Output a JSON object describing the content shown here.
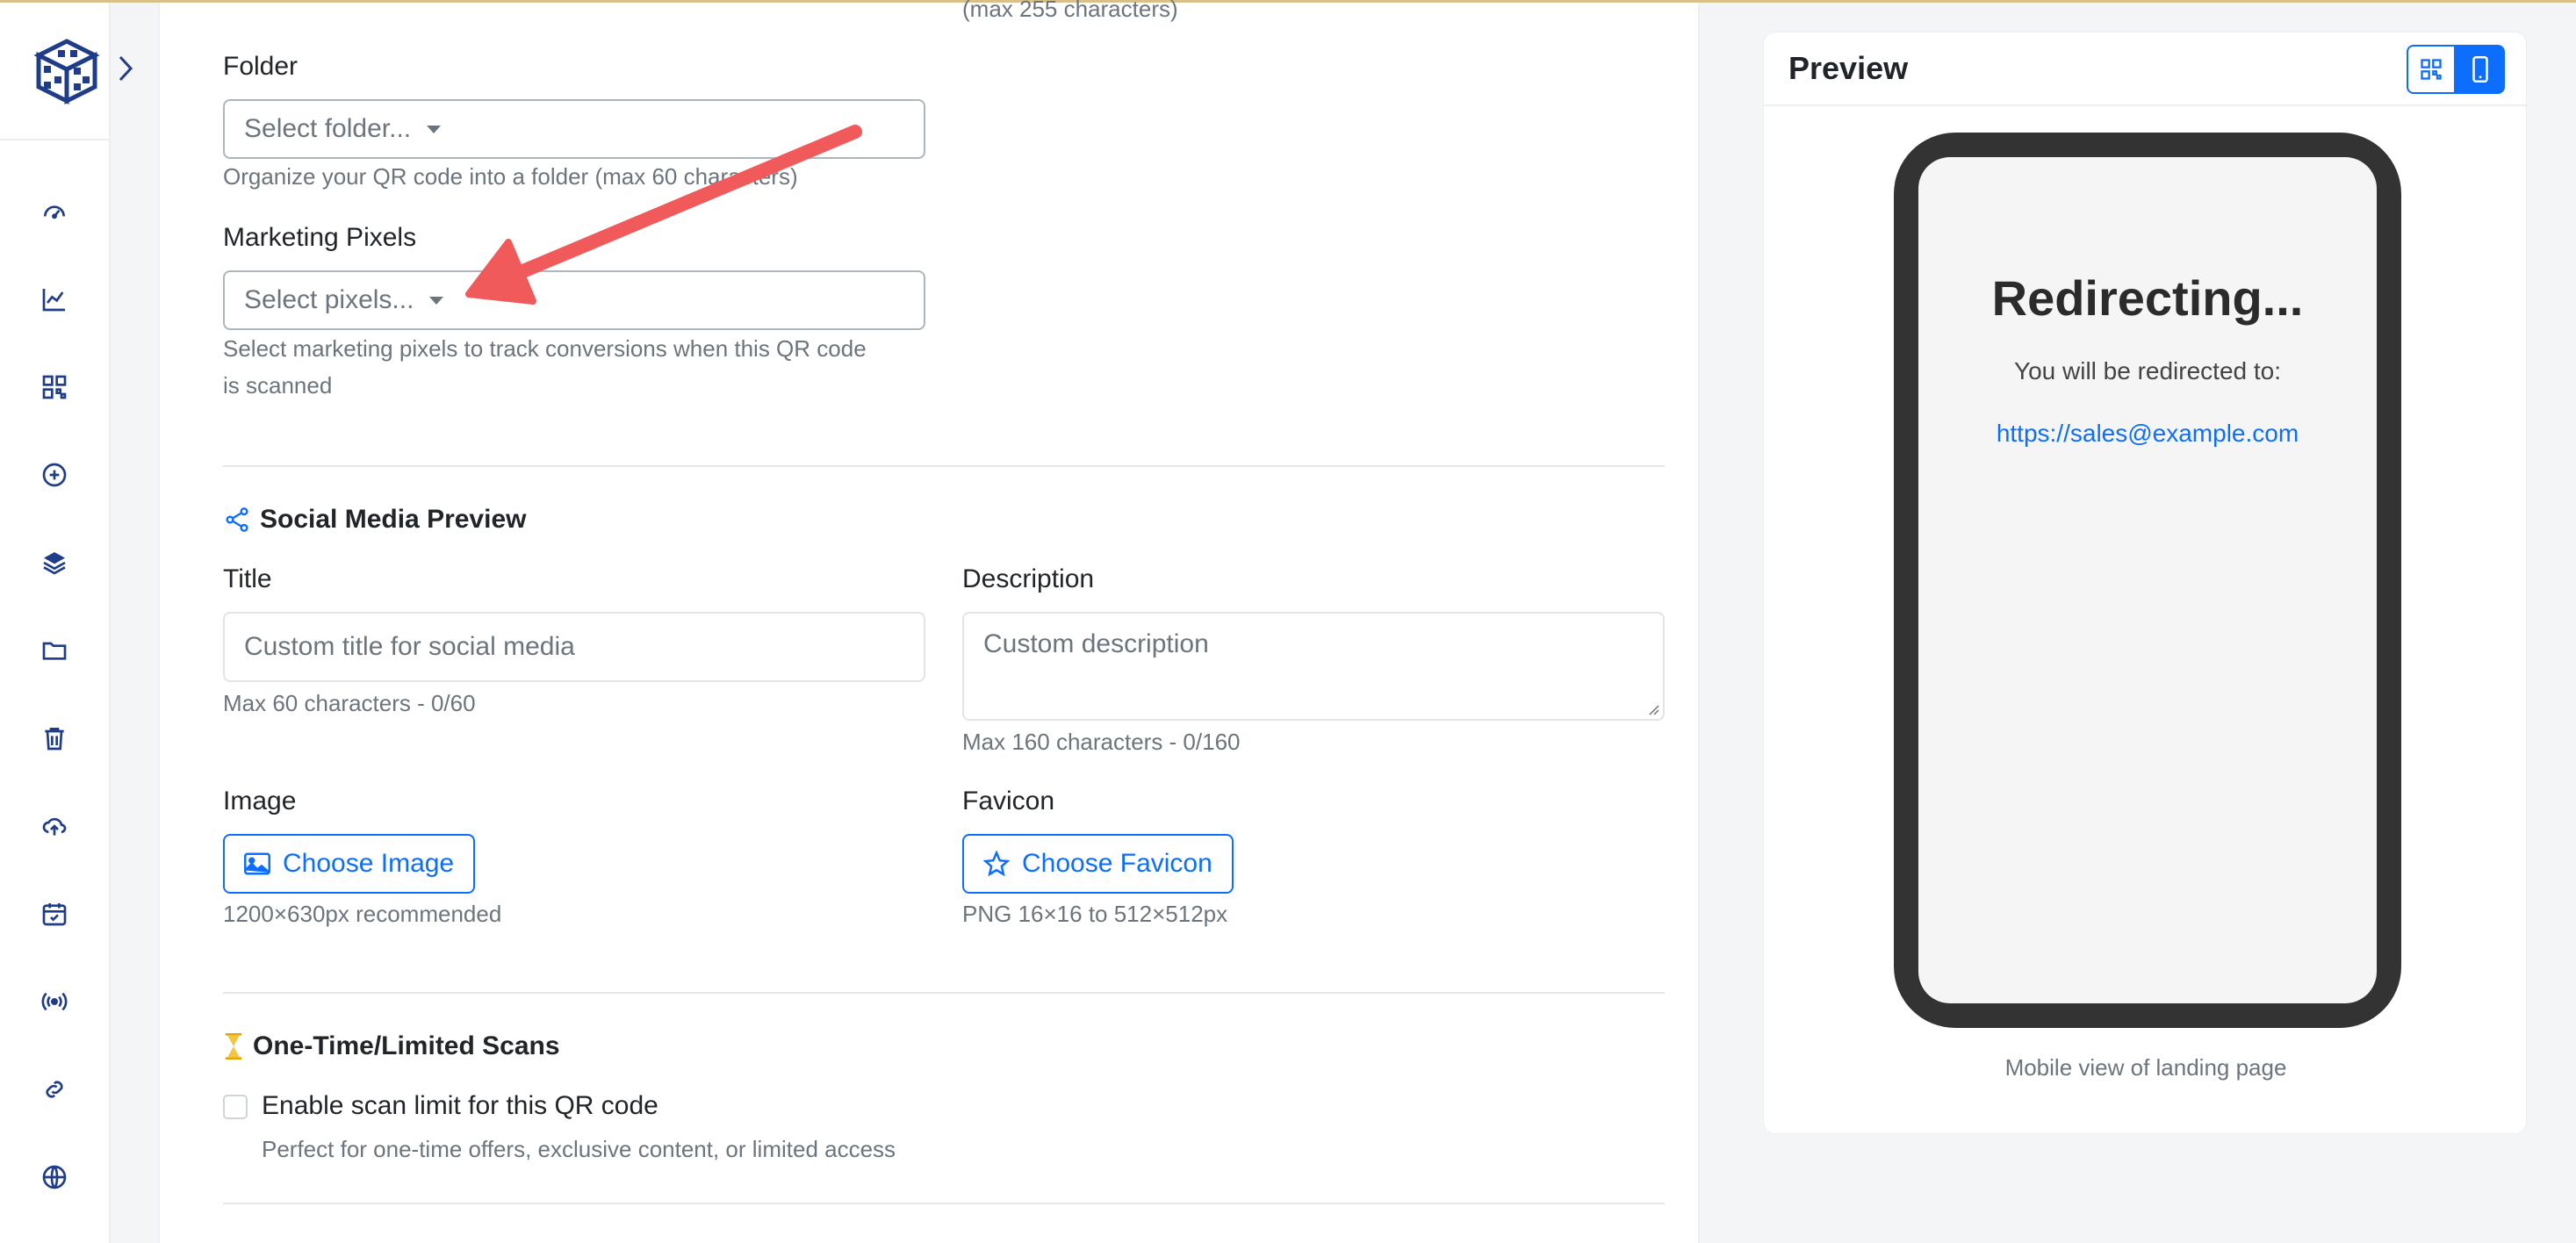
{
  "form": {
    "top_cutoff_hint": "(max 255 characters)",
    "folder": {
      "label": "Folder",
      "placeholder": "Select folder...",
      "help": "Organize your QR code into a folder (max 60 characters)"
    },
    "pixels": {
      "label": "Marketing Pixels",
      "placeholder": "Select pixels...",
      "help_line1": "Select marketing pixels to track conversions when this QR code",
      "help_line2": "is scanned"
    },
    "social": {
      "section_title": "Social Media Preview",
      "title_label": "Title",
      "title_placeholder": "Custom title for social media",
      "title_help": "Max 60 characters - 0/60",
      "desc_label": "Description",
      "desc_placeholder": "Custom description",
      "desc_help": "Max 160 characters - 0/160",
      "image_label": "Image",
      "image_button": "Choose Image",
      "image_help": "1200×630px recommended",
      "favicon_label": "Favicon",
      "favicon_button": "Choose Favicon",
      "favicon_help": "PNG 16×16 to 512×512px"
    },
    "limited": {
      "section_title": "One-Time/Limited Scans",
      "checkbox_label": "Enable scan limit for this QR code",
      "checkbox_help": "Perfect for one-time offers, exclusive content, or limited access"
    }
  },
  "preview": {
    "title": "Preview",
    "screen_title": "Redirecting...",
    "screen_subtitle": "You will be redirected to:",
    "screen_link": "https://sales@example.com",
    "caption": "Mobile view of landing page"
  },
  "sidebar": {
    "icons": [
      "dashboard-icon",
      "analytics-icon",
      "qr-code-icon",
      "add-icon",
      "layers-icon",
      "folder-icon",
      "trash-icon",
      "upload-cloud-icon",
      "calendar-check-icon",
      "broadcast-icon",
      "link-icon",
      "globe-icon"
    ]
  },
  "colors": {
    "accent": "#0d6efd",
    "annotation_arrow": "#f05a5b",
    "phone_frame": "#333333"
  }
}
